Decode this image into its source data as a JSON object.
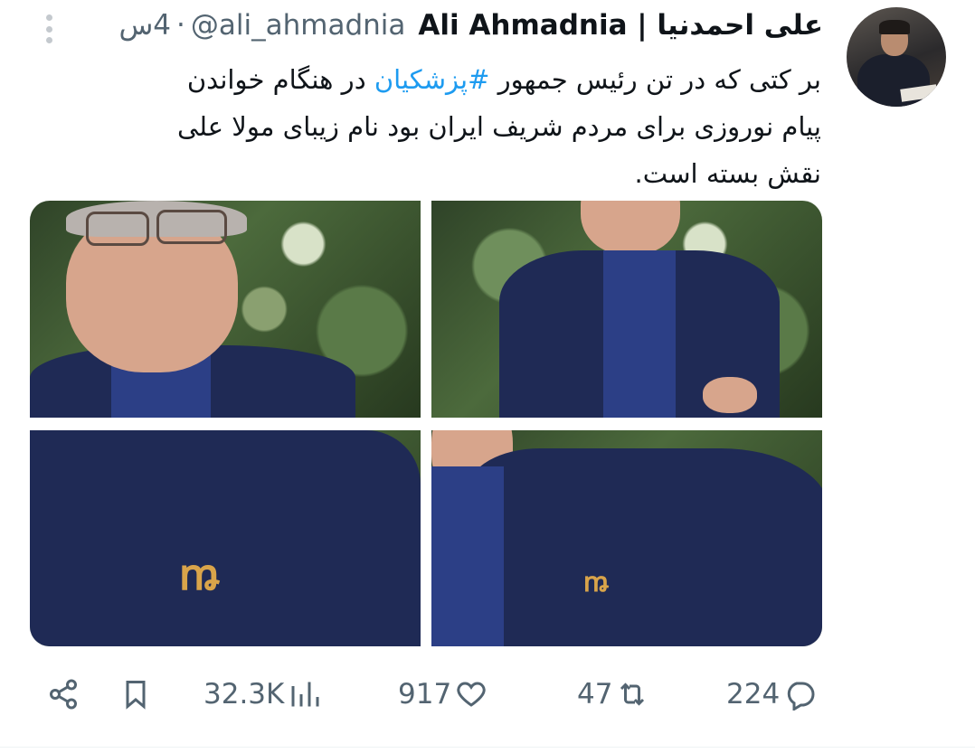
{
  "tweet": {
    "display_name": "Ali Ahmadnia | علی احمدنیا",
    "handle": "@ali_ahmadnia",
    "separator": "·",
    "time": "4س",
    "text_before": "بر کتی که در تن رئیس جمهور ",
    "hashtag": "#پزشکیان",
    "text_after": " در هنگام خواندن پیام نوروزی برای مردم شریف ایران بود نام زیبای مولا علی نقش بسته است."
  },
  "actions": {
    "views": "32.3K",
    "likes": "917",
    "retweets": "47",
    "replies": "224"
  },
  "colors": {
    "text": "#0f1419",
    "secondary": "#536471",
    "link": "#1d9bf0",
    "jacket": "#1f2a55"
  },
  "icons": [
    "more-vertical-icon",
    "share-icon",
    "bookmark-icon",
    "views-icon",
    "like-icon",
    "retweet-icon",
    "reply-icon"
  ]
}
